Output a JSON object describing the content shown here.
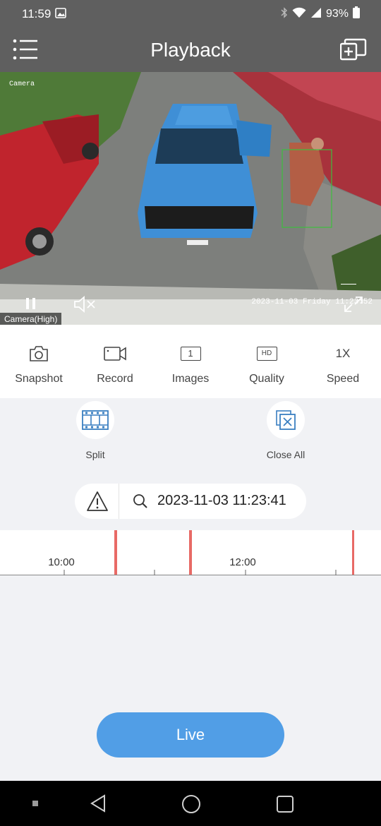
{
  "status_bar": {
    "time": "11:59",
    "battery": "93%"
  },
  "app_bar": {
    "title": "Playback"
  },
  "video": {
    "camera_overlay": "Camera",
    "timestamp_overlay": "2023-11-03 Friday 11:23:52",
    "quality_label": "Camera(High)"
  },
  "toolbar": {
    "items": [
      {
        "label": "Snapshot",
        "icon": "camera-icon"
      },
      {
        "label": "Record",
        "icon": "video-record-icon"
      },
      {
        "label": "Images",
        "icon": "images-icon",
        "icon_text": "1"
      },
      {
        "label": "Quality",
        "icon": "hd-icon",
        "icon_text": "HD"
      },
      {
        "label": "Speed",
        "icon": "speed-icon",
        "icon_text": "1X"
      }
    ]
  },
  "split": {
    "label": "Split",
    "icon": "film-strip-icon"
  },
  "close_all": {
    "label": "Close All",
    "icon": "close-windows-icon"
  },
  "search": {
    "datetime": "2023-11-03 11:23:41",
    "alert_icon": "warning-icon",
    "search_icon": "search-icon"
  },
  "timeline": {
    "labels": [
      "10:00",
      "12:00"
    ],
    "event_marker_color": "#e86a66"
  },
  "live_button": {
    "label": "Live"
  },
  "colors": {
    "app_bar": "#5f5f5f",
    "accent": "#519ee6",
    "background": "#f1f2f5"
  }
}
